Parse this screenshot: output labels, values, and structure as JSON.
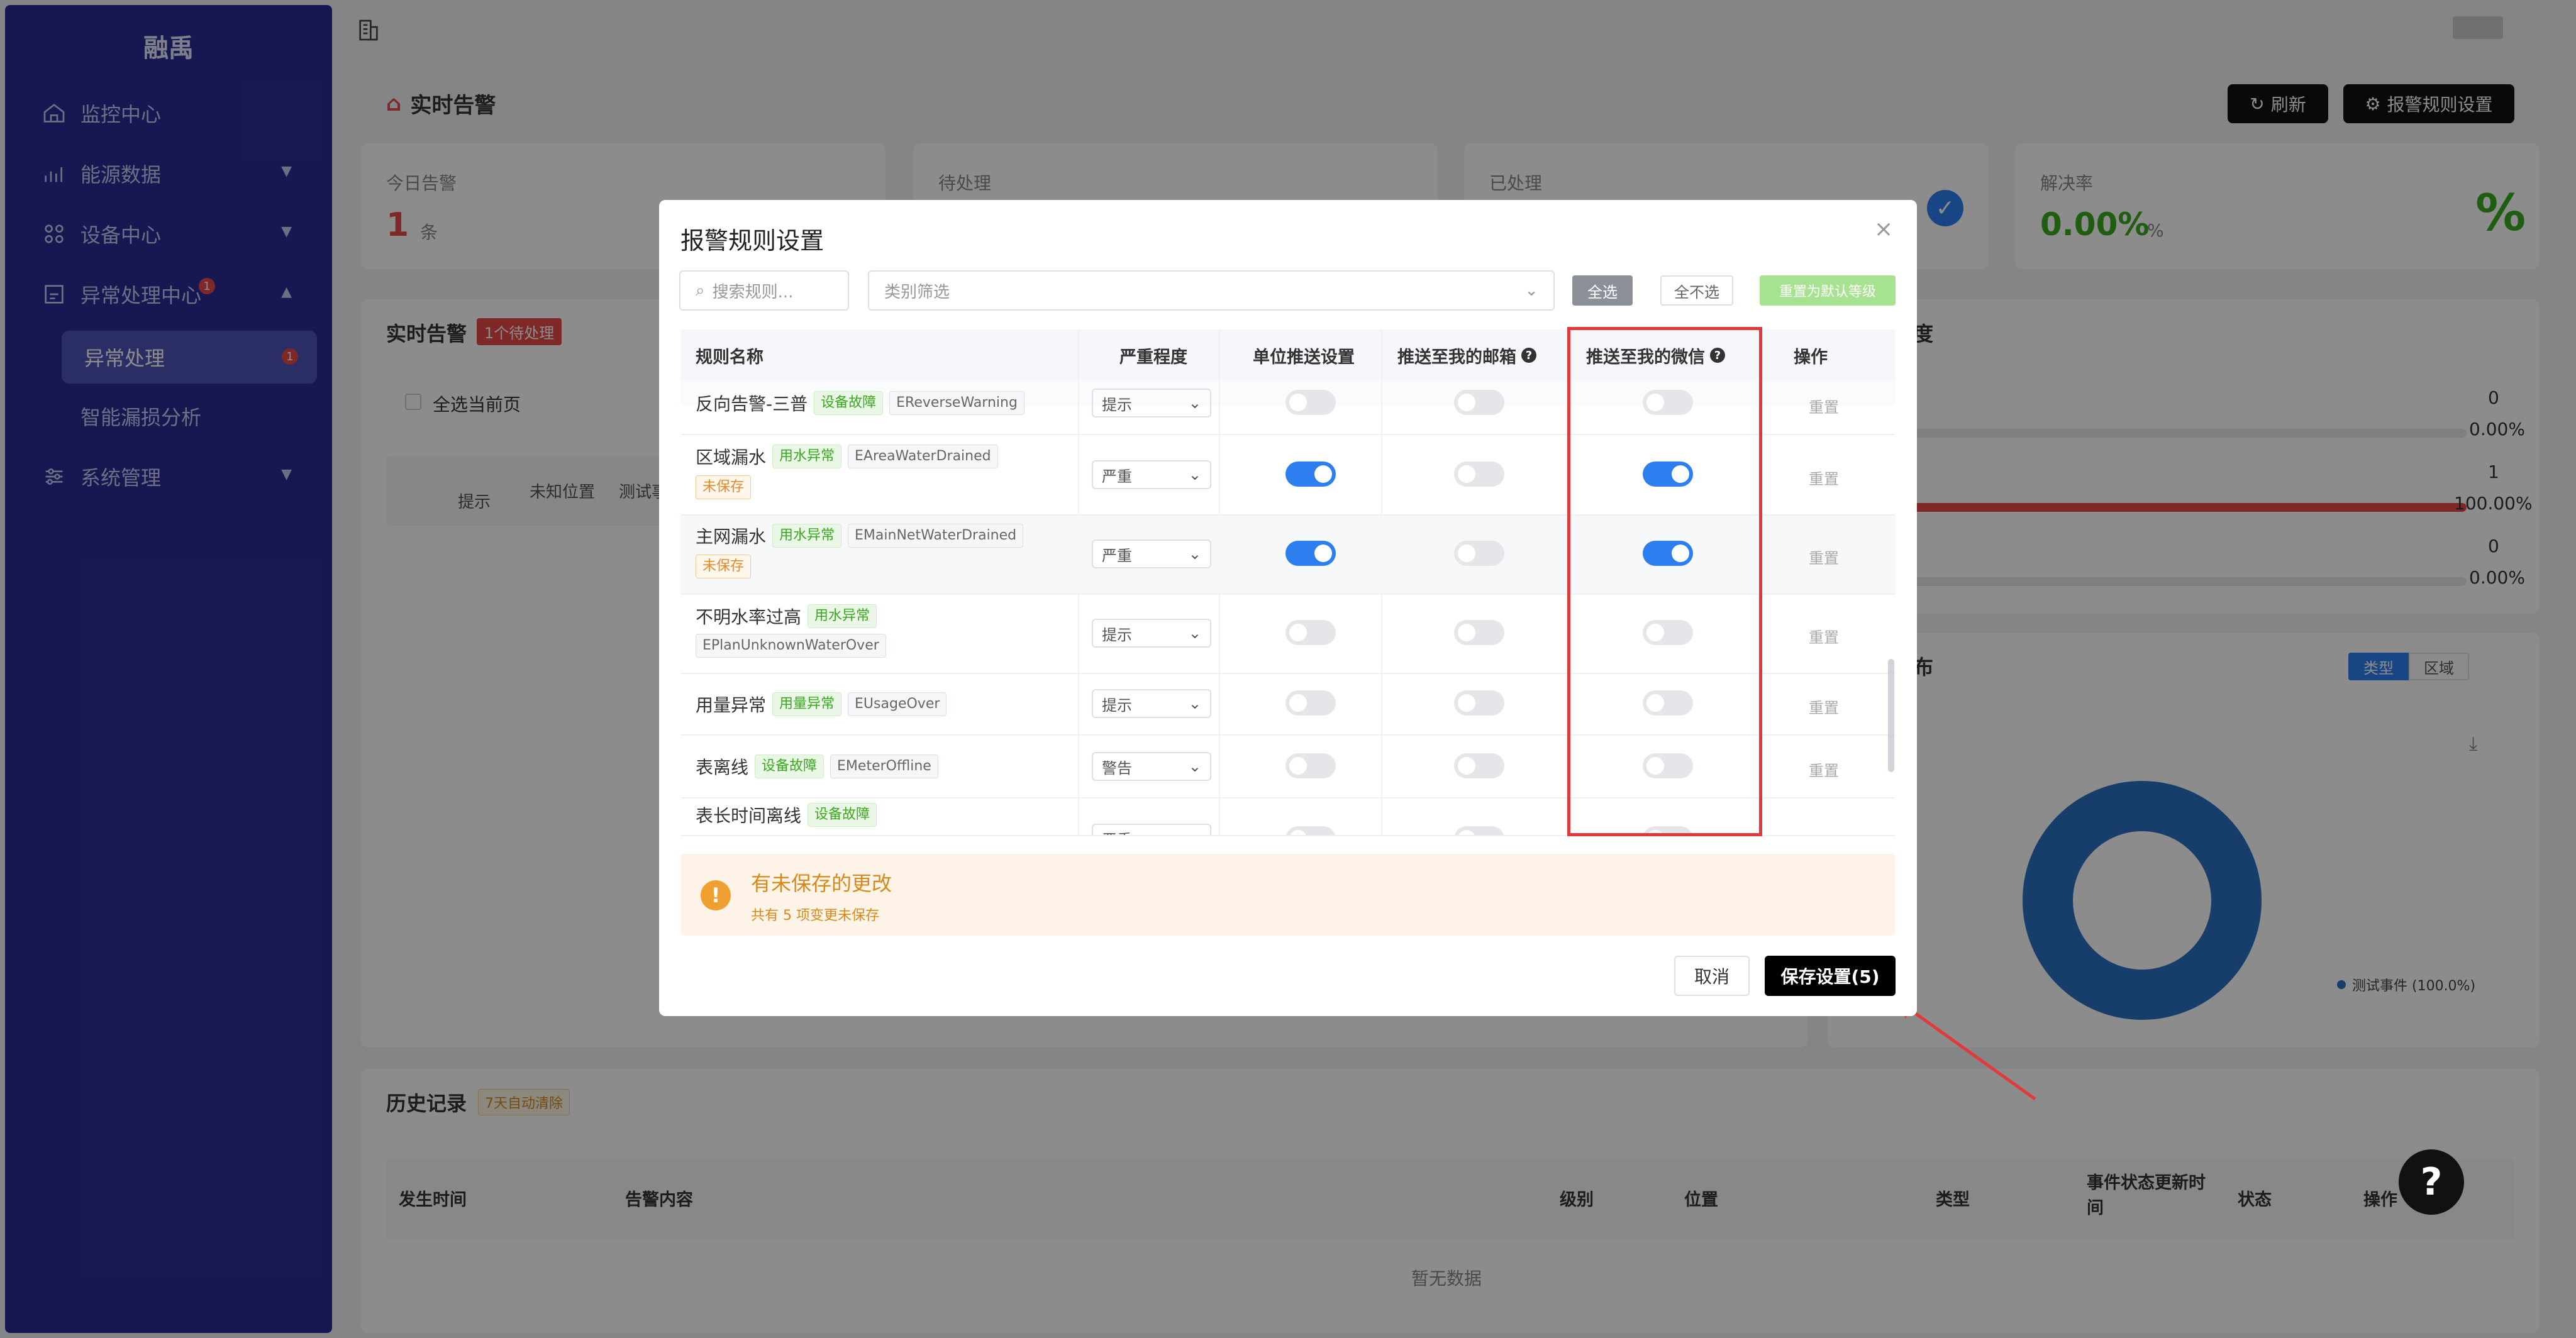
{
  "app": {
    "name": "融禹"
  },
  "nav": [
    {
      "label": "监控中心",
      "icon": "home-icon"
    },
    {
      "label": "能源数据",
      "icon": "chart-icon"
    },
    {
      "label": "设备中心",
      "icon": "device-icon"
    },
    {
      "label": "异常处理中心",
      "icon": "alert-icon",
      "badge": "1"
    },
    {
      "label": "异常处理",
      "badge": "1"
    },
    {
      "label": "智能漏损分析"
    },
    {
      "label": "系统管理",
      "icon": "settings-icon"
    }
  ],
  "page": {
    "title": "实时告警",
    "refresh_label": "刷新",
    "rules_label": "报警规则设置"
  },
  "stats": [
    {
      "label": "今日告警",
      "value": "1",
      "unit": "条"
    },
    {
      "label": "待处理"
    },
    {
      "label": "已处理"
    },
    {
      "label": "解决率",
      "value": "0.00%",
      "unit": "%",
      "icon": "%"
    }
  ],
  "realtime": {
    "title": "实时告警",
    "badge": "1个待处理",
    "select_all": "全选当前页",
    "row_level": "提示",
    "row_loc": "未知位置",
    "row_name": "测试事"
  },
  "right_stats": {
    "title": "度",
    "rows": [
      {
        "count": "0",
        "pct": "0.00%"
      },
      {
        "count": "1",
        "pct": "100.00%"
      },
      {
        "count": "0",
        "pct": "0.00%"
      }
    ]
  },
  "distribution": {
    "title": "布",
    "tab_type": "类型",
    "tab_region": "区域",
    "legend": "测试事件 (100.0%)"
  },
  "history": {
    "title": "历史记录",
    "badge": "7天自动清除",
    "columns": [
      "发生时间",
      "告警内容",
      "级别",
      "位置",
      "类型",
      "事件状态更新时间",
      "状态",
      "操作"
    ],
    "empty": "暂无数据"
  },
  "modal": {
    "title": "报警规则设置",
    "search_placeholder": "搜索规则...",
    "category_placeholder": "类别筛选",
    "select_all": "全选",
    "select_none": "全不选",
    "reset_default": "重置为默认等级",
    "columns": [
      "规则名称",
      "严重程度",
      "单位推送设置",
      "推送至我的邮箱",
      "推送至我的微信",
      "操作"
    ],
    "rows": [
      {
        "name": "反向告警-三普",
        "tag": "设备故障",
        "code": "EReverseWarning",
        "severity": "提示",
        "unit": false,
        "email": false,
        "wechat": false,
        "unsaved": false
      },
      {
        "name": "区域漏水",
        "tag": "用水异常",
        "code": "EAreaWaterDrained",
        "severity": "严重",
        "unit": true,
        "email": false,
        "wechat": true,
        "unsaved": true
      },
      {
        "name": "主网漏水",
        "tag": "用水异常",
        "code": "EMainNetWaterDrained",
        "severity": "严重",
        "unit": true,
        "email": false,
        "wechat": true,
        "unsaved": true
      },
      {
        "name": "不明水率过高",
        "tag": "用水异常",
        "code": "EPlanUnknownWaterOver",
        "severity": "提示",
        "unit": false,
        "email": false,
        "wechat": false,
        "unsaved": false
      },
      {
        "name": "用量异常",
        "tag": "用量异常",
        "code": "EUsageOver",
        "severity": "提示",
        "unit": false,
        "email": false,
        "wechat": false,
        "unsaved": false
      },
      {
        "name": "表离线",
        "tag": "设备故障",
        "code": "EMeterOffline",
        "severity": "警告",
        "unit": false,
        "email": false,
        "wechat": false,
        "unsaved": false
      },
      {
        "name": "表长时间离线",
        "tag": "设备故障",
        "code": "",
        "severity": "严重",
        "unit": false,
        "email": false,
        "wechat": false,
        "unsaved": false
      }
    ],
    "unsaved_label": "未保存",
    "reset_label": "重置",
    "warning_title": "有未保存的更改",
    "warning_sub": "共有 5 项变更未保存",
    "cancel_label": "取消",
    "save_label": "保存设置(5)"
  },
  "help": "?"
}
